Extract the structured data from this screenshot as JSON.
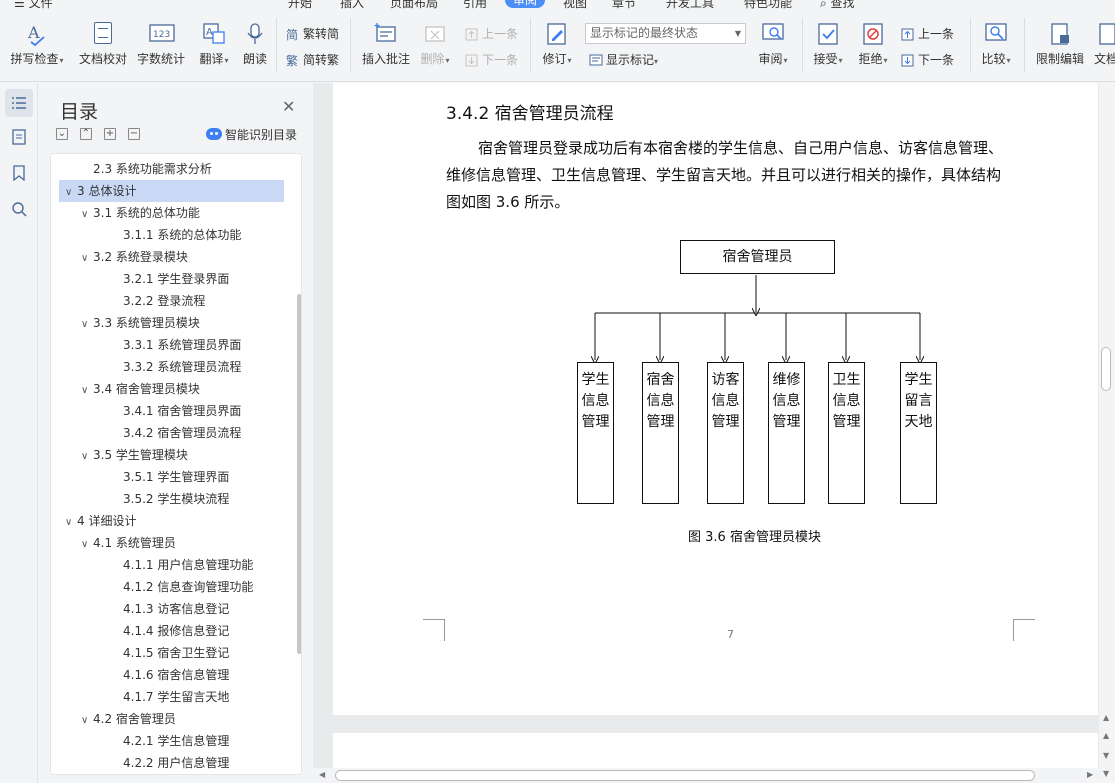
{
  "menu": {
    "file": "文件",
    "tabs": [
      "开始",
      "插入",
      "页面布局",
      "引用",
      "审阅",
      "视图",
      "章节",
      "开发工具",
      "特色功能"
    ],
    "active_tab": "审阅",
    "search": "查找"
  },
  "ribbon": {
    "spellcheck": "拼写检查",
    "proofread": "文档校对",
    "wordcount": "字数统计",
    "translate": "翻译",
    "read_aloud": "朗读",
    "trad_to_simp": "繁转简",
    "simp_to_trad": "简转繁",
    "insert_comment": "插入批注",
    "delete": "删除",
    "prev_comment": "上一条",
    "next_comment": "下一条",
    "track_changes": "修订",
    "markup_state": "显示标记的最终状态",
    "show_markup": "显示标记",
    "review": "审阅",
    "accept": "接受",
    "reject": "拒绝",
    "prev_change": "上一条",
    "next_change": "下一条",
    "compare": "比较",
    "restrict_edit": "限制编辑",
    "doc_permission": "文档"
  },
  "toc": {
    "title": "目录",
    "smart_recognize": "智能识别目录",
    "items": [
      {
        "text": "2.3  系统功能需求分析",
        "level": 2,
        "toggle": ""
      },
      {
        "text": "3  总体设计",
        "level": 1,
        "toggle": "∨",
        "selected": true
      },
      {
        "text": "3.1  系统的总体功能",
        "level": 2,
        "toggle": "∨"
      },
      {
        "text": "3.1.1  系统的总体功能",
        "level": 3,
        "toggle": ""
      },
      {
        "text": "3.2  系统登录模块",
        "level": 2,
        "toggle": "∨"
      },
      {
        "text": "3.2.1  学生登录界面",
        "level": 3,
        "toggle": ""
      },
      {
        "text": "3.2.2  登录流程",
        "level": 3,
        "toggle": ""
      },
      {
        "text": "3.3  系统管理员模块",
        "level": 2,
        "toggle": "∨"
      },
      {
        "text": "3.3.1  系统管理员界面",
        "level": 3,
        "toggle": ""
      },
      {
        "text": "3.3.2  系统管理员流程",
        "level": 3,
        "toggle": ""
      },
      {
        "text": "3.4  宿舍管理员模块",
        "level": 2,
        "toggle": "∨"
      },
      {
        "text": "3.4.1  宿舍管理员界面",
        "level": 3,
        "toggle": ""
      },
      {
        "text": "3.4.2  宿舍管理员流程",
        "level": 3,
        "toggle": ""
      },
      {
        "text": "3.5  学生管理模块",
        "level": 2,
        "toggle": "∨"
      },
      {
        "text": "3.5.1  学生管理界面",
        "level": 3,
        "toggle": ""
      },
      {
        "text": "3.5.2  学生模块流程",
        "level": 3,
        "toggle": ""
      },
      {
        "text": "4  详细设计",
        "level": 1,
        "toggle": "∨"
      },
      {
        "text": "4.1  系统管理员",
        "level": 2,
        "toggle": "∨"
      },
      {
        "text": "4.1.1  用户信息管理功能",
        "level": 3,
        "toggle": ""
      },
      {
        "text": "4.1.2  信息查询管理功能",
        "level": 3,
        "toggle": ""
      },
      {
        "text": "4.1.3  访客信息登记",
        "level": 3,
        "toggle": ""
      },
      {
        "text": "4.1.4  报修信息登记",
        "level": 3,
        "toggle": ""
      },
      {
        "text": "4.1.5  宿舍卫生登记",
        "level": 3,
        "toggle": ""
      },
      {
        "text": "4.1.6  宿舍信息管理",
        "level": 3,
        "toggle": ""
      },
      {
        "text": "4.1.7  学生留言天地",
        "level": 3,
        "toggle": ""
      },
      {
        "text": "4.2  宿舍管理员",
        "level": 2,
        "toggle": "∨"
      },
      {
        "text": "4.2.1  学生信息管理",
        "level": 3,
        "toggle": ""
      },
      {
        "text": "4.2.2  用户信息管理",
        "level": 3,
        "toggle": ""
      }
    ]
  },
  "document": {
    "heading": "3.4.2  宿舍管理员流程",
    "paragraph": "宿舍管理员登录成功后有本宿舍楼的学生信息、自己用户信息、访客信息管理、维修信息管理、卫生信息管理、学生留言天地。并且可以进行相关的操作，具体结构图如图 3.6 所示。",
    "diagram": {
      "root": "宿舍管理员",
      "children": [
        "学生信息管理",
        "宿舍信息管理",
        "访客信息管理",
        "维修信息管理",
        "卫生信息管理",
        "学生留言天地"
      ]
    },
    "caption": "图 3.6 宿舍管理员模块",
    "page_number": "7"
  }
}
